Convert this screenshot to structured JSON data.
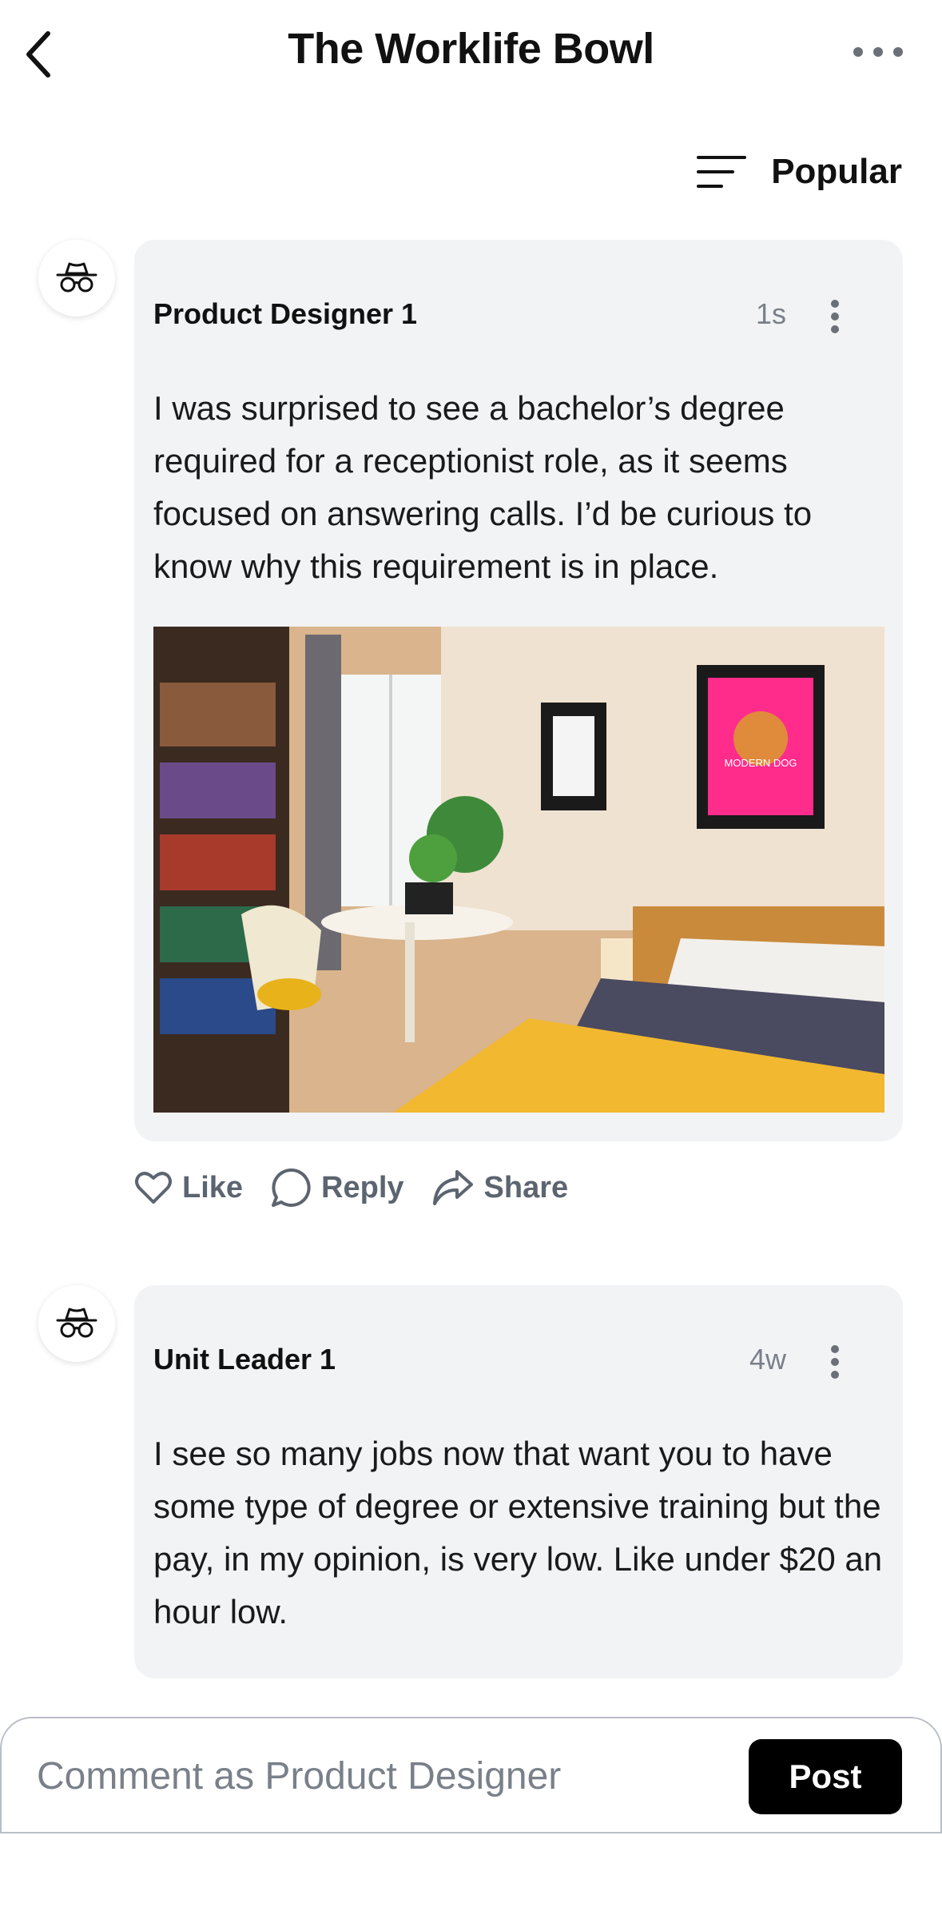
{
  "header": {
    "title": "The Worklife Bowl",
    "back_icon": "chevron-left-icon",
    "more_icon": "more-horizontal-icon"
  },
  "sort": {
    "label": "Popular",
    "icon": "sort-lines-icon"
  },
  "posts": [
    {
      "author": "Product Designer 1",
      "time": "1s",
      "text": "I was surprised to see a bachelor’s degree required for a receptionist role, as it seems focused on answering calls. I’d be curious to know why this requirement is in place.",
      "image_text": "MODERN DOG",
      "actions": {
        "like": "Like",
        "reply": "Reply",
        "share": "Share"
      }
    },
    {
      "author": "Unit Leader 1",
      "time": "4w",
      "text": "I see so many jobs now that want you to have some type of degree or extensive training but the pay, in my opinion, is very low. Like under $20 an hour low."
    }
  ],
  "composer": {
    "placeholder": "Comment as Product Designer",
    "post_label": "Post"
  },
  "colors": {
    "card_bg": "#f2f3f5",
    "action_text": "#5c6470",
    "post_button": "#000000"
  }
}
